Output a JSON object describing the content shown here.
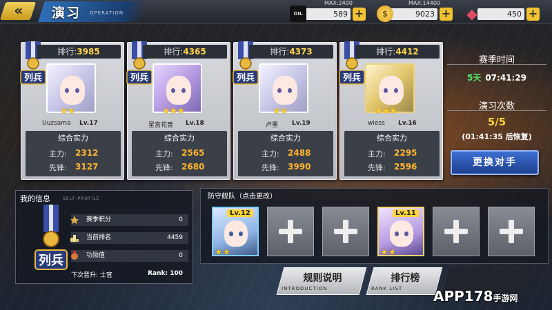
{
  "header": {
    "back_icon": "double-chevron-left-icon",
    "title": "演习",
    "subtitle": "OPERATION"
  },
  "resources": [
    {
      "icon": "oil-icon",
      "max": "MAX:2400",
      "value": "589"
    },
    {
      "icon": "coin-icon",
      "max": "MAX:14400",
      "value": "9023"
    },
    {
      "icon": "gem-icon",
      "max": "",
      "value": "450"
    }
  ],
  "opponents": [
    {
      "rank_label": "排行:",
      "rank": "3985",
      "name": "Uuzsama",
      "level": "Lv.17",
      "stars": "★★",
      "power_label": "综合实力",
      "main_label": "主力:",
      "main": "2312",
      "vanguard_label": "先锋:",
      "vanguard": "3127"
    },
    {
      "rank_label": "排行:",
      "rank": "4365",
      "name": "星宫花音",
      "level": "Lv.18",
      "stars": "★★★",
      "power_label": "综合实力",
      "main_label": "主力:",
      "main": "2565",
      "vanguard_label": "先锋:",
      "vanguard": "2680"
    },
    {
      "rank_label": "排行:",
      "rank": "4373",
      "name": "卢墨",
      "level": "Lv.19",
      "stars": "★★",
      "power_label": "综合实力",
      "main_label": "主力:",
      "main": "2488",
      "vanguard_label": "先锋:",
      "vanguard": "3990"
    },
    {
      "rank_label": "排行:",
      "rank": "4412",
      "name": "wiess",
      "level": "Lv.16",
      "stars": "★★★",
      "power_label": "综合实力",
      "main_label": "主力:",
      "main": "2295",
      "vanguard_label": "先锋:",
      "vanguard": "2596"
    }
  ],
  "season": {
    "label": "赛季时间",
    "days": "5天",
    "time": "07:41:29"
  },
  "exercise": {
    "label": "演习次数",
    "count": "5/5",
    "recover": "(01:41:35 后恢复)"
  },
  "change_button": "更换对手",
  "my_info": {
    "title": "我的信息",
    "subtitle": "SELF-PROFILE",
    "rows": [
      {
        "label": "赛季积分",
        "value": "0"
      },
      {
        "label": "当前排名",
        "value": "4459"
      },
      {
        "label": "功勋值",
        "value": "0"
      }
    ],
    "next_label": "下次晋升: 士官",
    "next_rank": "Rank: 100"
  },
  "fleet": {
    "title": "防守舰队（点击更改）",
    "ships": [
      {
        "level": "Lv.12",
        "stars": "★★"
      },
      {
        "level": "Lv.11",
        "stars": "★★"
      }
    ]
  },
  "buttons": {
    "rules": "规则说明",
    "rules_sub": "INTRODUCTION",
    "ranking": "排行榜",
    "ranking_sub": "RANK LIST"
  },
  "watermark": {
    "brand": "APP178",
    "cn": "手游网"
  },
  "colors": {
    "accent_gold": "#ffd24a",
    "stat_orange": "#ffb52e",
    "green_time": "#58e46b",
    "button_blue": "#3d6fd1"
  }
}
